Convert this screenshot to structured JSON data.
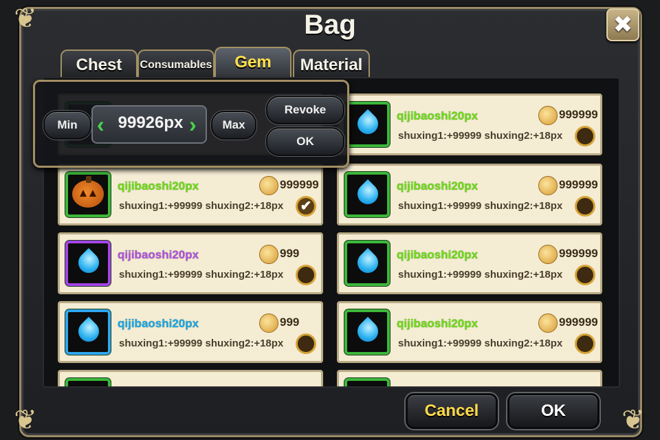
{
  "title": "Bag",
  "close_label": "✖",
  "tabs": [
    {
      "label": "Chest"
    },
    {
      "label": "Consumables"
    },
    {
      "label": "Gem"
    },
    {
      "label": "Material"
    }
  ],
  "active_tab": "Gem",
  "quantity_popup": {
    "min_label": "Min",
    "max_label": "Max",
    "value": "99926px",
    "revoke_label": "Revoke",
    "ok_label": "OK"
  },
  "items": [
    {
      "name": "qijibaoshi20px",
      "price": "999999",
      "stats": "shuxing1:+99999  shuxing2:+18px",
      "checked": false
    },
    {
      "name": "qijibaoshi20px",
      "price": "999999",
      "stats": "shuxing1:+99999  shuxing2:+18px",
      "checked": true
    },
    {
      "name": "qijibaoshi20px",
      "price": "999999",
      "stats": "shuxing1:+99999  shuxing2:+18px",
      "checked": false
    },
    {
      "name": "qijibaoshi20px",
      "price": "999",
      "stats": "shuxing1:+99999  shuxing2:+18px",
      "checked": false
    },
    {
      "name": "qijibaoshi20px",
      "price": "999999",
      "stats": "shuxing1:+99999  shuxing2:+18px",
      "checked": false
    },
    {
      "name": "qijibaoshi20px",
      "price": "999",
      "stats": "shuxing1:+99999  shuxing2:+18px",
      "checked": false
    },
    {
      "name": "qijibaoshi20px",
      "price": "999999",
      "stats": "shuxing1:+99999  shuxing2:+18px",
      "checked": false
    }
  ],
  "footer": {
    "cancel_label": "Cancel",
    "ok_label": "OK"
  },
  "colors": {
    "rarity_green": "#3db83b",
    "rarity_purple": "#a544e8",
    "rarity_blue": "#2ea6ef",
    "accent_gold": "#ffd94a"
  }
}
